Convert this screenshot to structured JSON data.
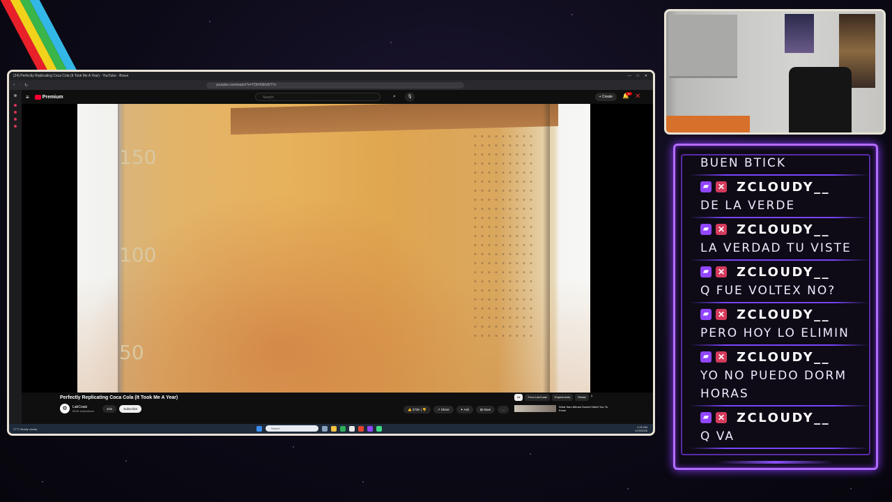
{
  "browser": {
    "window_title": "(24) Perfectly Replicating Coca Cola (It Took Me A Year) - YouTube - Brave",
    "url": "youtube.com/watch?v=TDkH3EbWTYc"
  },
  "youtube": {
    "logo_text": "Premium",
    "search_placeholder": "Search",
    "create_label": "+ Create",
    "notifications_count": "9+",
    "video_title": "Perfectly Replicating Coca Cola (It Took Me A Year)",
    "channel_name": "LabCoatz",
    "channel_subs": "504K subscribers",
    "join_label": "Join",
    "subscribe_label": "Subscribe",
    "likes": "373K",
    "share_label": "Share",
    "ask_label": "Ask",
    "save_label": "Save",
    "more_label": "...",
    "chips": [
      "All",
      "From LabCoatz",
      "Experiments",
      "Relate"
    ],
    "rec_title": "What Sam Altman Doesn't Want You To Know",
    "video_numbers": [
      "150",
      "100",
      "50"
    ]
  },
  "taskbar": {
    "weather_temp": "17°C",
    "weather_desc": "Mostly cloudy",
    "search_placeholder": "Search",
    "time": "4:20 AM",
    "date": "1/19/2026"
  },
  "chat": {
    "messages": [
      {
        "user": "",
        "text": "BUEN BTICK"
      },
      {
        "user": "ZCLOUDY__",
        "text": "DE LA VERDE"
      },
      {
        "user": "ZCLOUDY__",
        "text": "LA VERDAD TU VISTE"
      },
      {
        "user": "ZCLOUDY__",
        "text": "Q FUE VOLTEX NO?"
      },
      {
        "user": "ZCLOUDY__",
        "text": "PERO HOY LO ELIMIN"
      },
      {
        "user": "ZCLOUDY__",
        "text": "YO NO PUEDO DORM"
      },
      {
        "user": "",
        "text": "HORAS"
      },
      {
        "user": "ZCLOUDY__",
        "text": "Q VA"
      }
    ]
  },
  "colors": {
    "accent_purple": "#b36cff",
    "twitch": "#9146ff",
    "yt_red": "#ff0033"
  }
}
